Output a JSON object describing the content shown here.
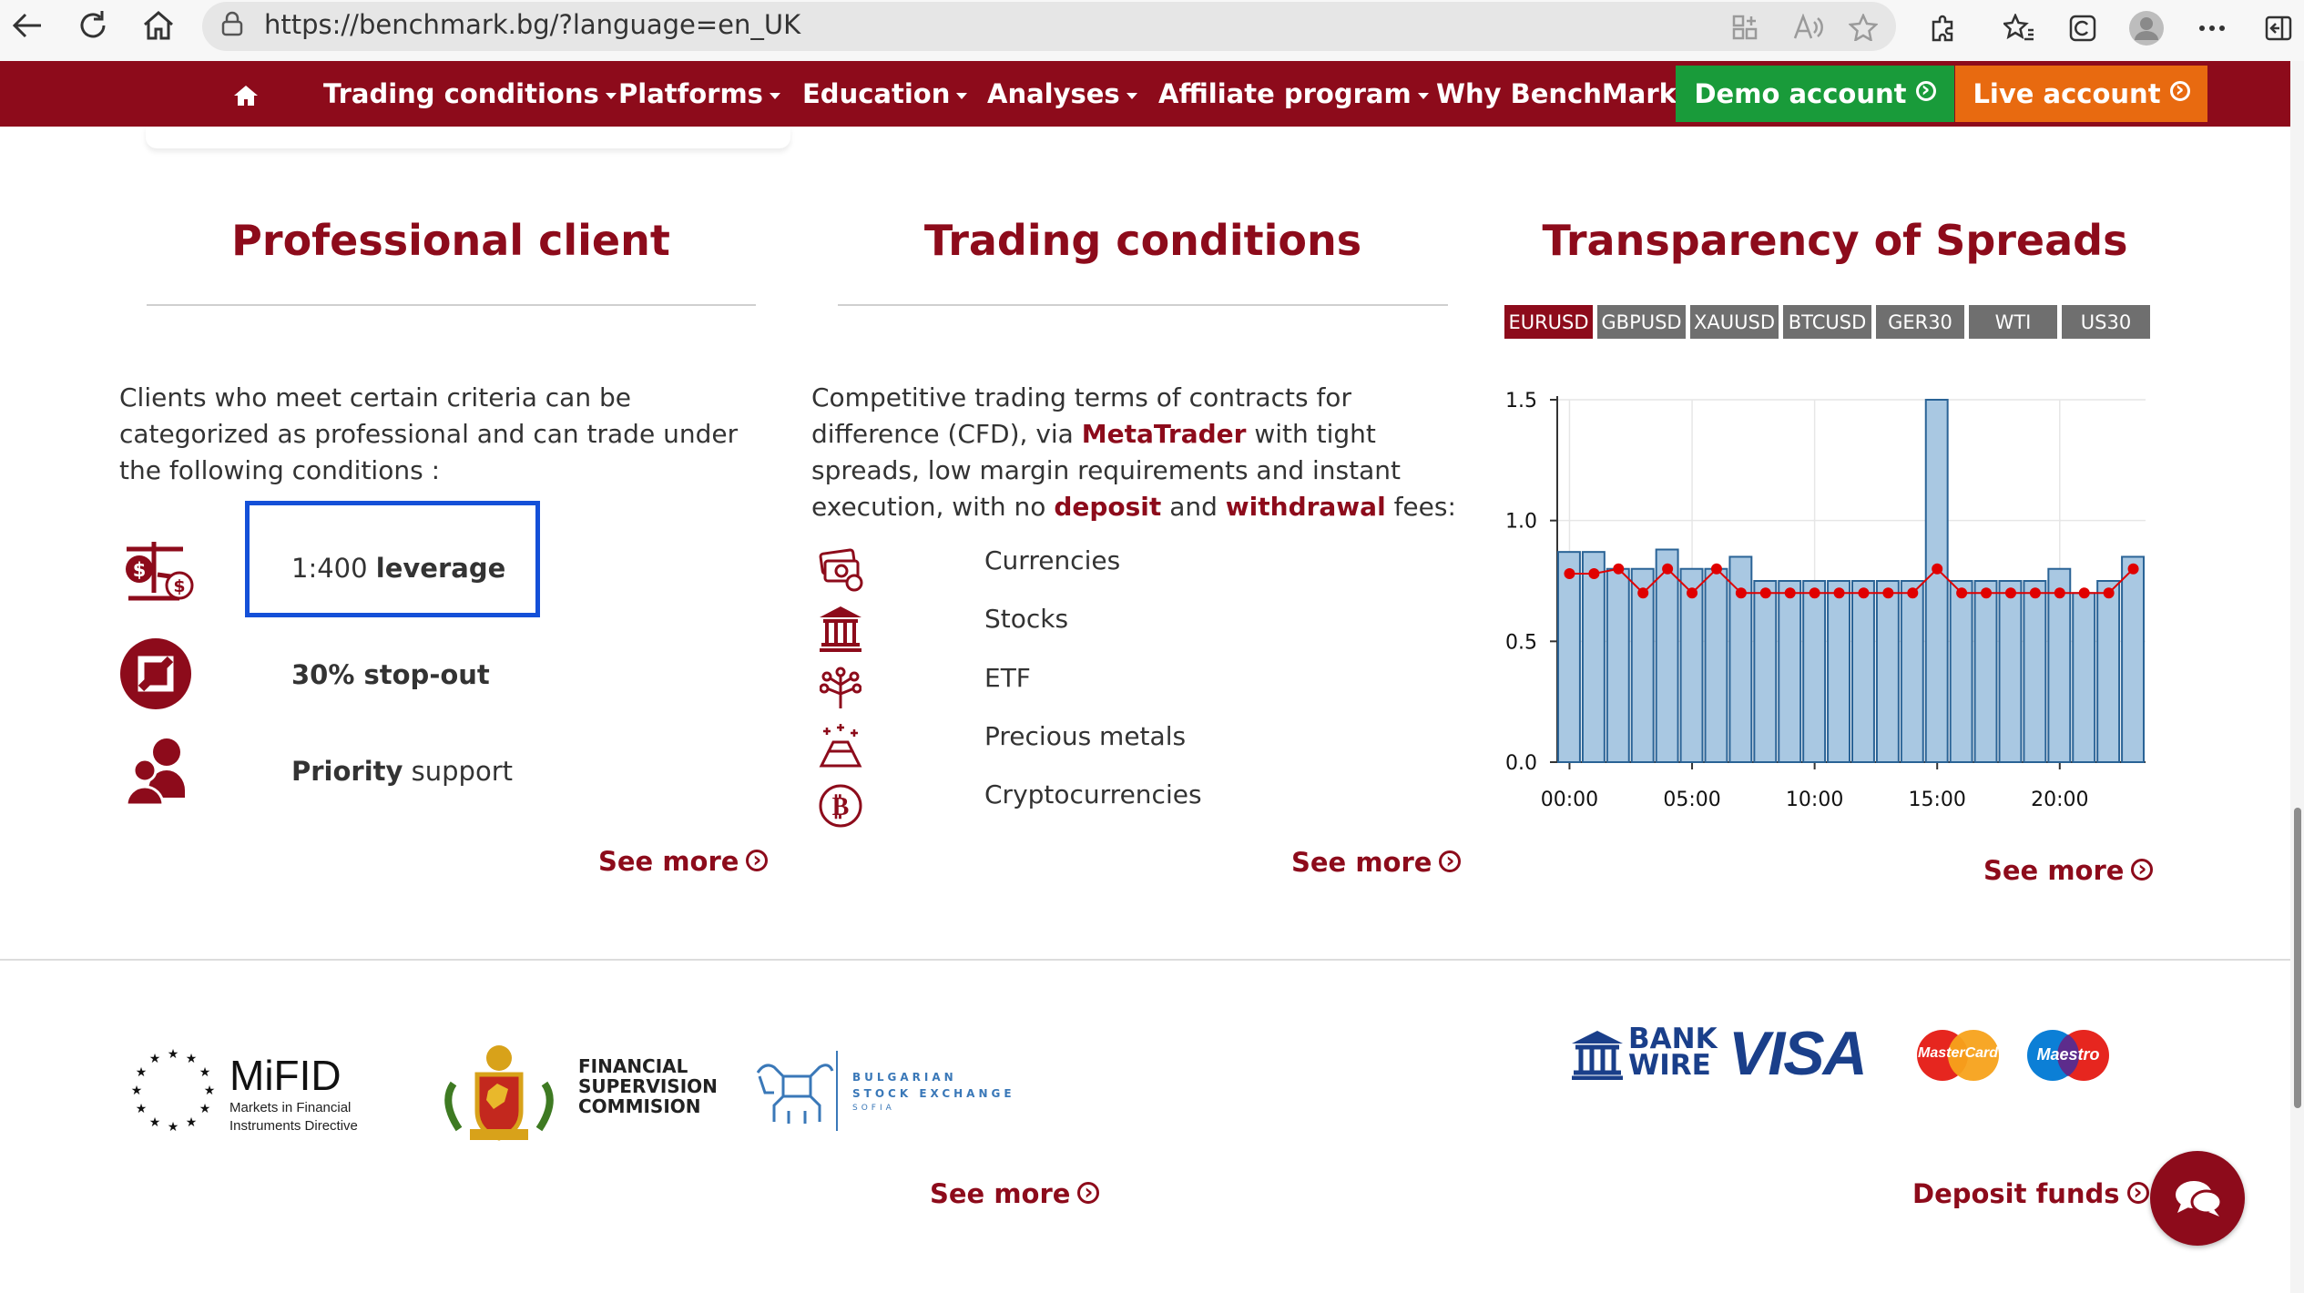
{
  "browser": {
    "url": "https://benchmark.bg/?language=en_UK"
  },
  "nav": {
    "items": [
      {
        "label": "Trading conditions"
      },
      {
        "label": "Platforms"
      },
      {
        "label": "Education"
      },
      {
        "label": "Analyses"
      },
      {
        "label": "Affiliate program"
      },
      {
        "label": "Why BenchMark"
      }
    ],
    "demo_label": "Demo account",
    "live_label": "Live account",
    "brand_color": "#8d0b1b",
    "demo_color": "#199b3a",
    "live_color": "#e86a10"
  },
  "professional": {
    "title": "Professional client",
    "intro": "Clients who meet certain criteria can be categorized as professional and can trade under the following conditions :",
    "features": [
      {
        "icon": "scales-icon",
        "pre": "1:400 ",
        "bold": "leverage",
        "post": ""
      },
      {
        "icon": "stop-out-icon",
        "pre": "",
        "bold": "30% stop-out",
        "post": ""
      },
      {
        "icon": "people-icon",
        "pre": "",
        "bold": "Priority",
        "post": " support"
      }
    ],
    "see_more": "See more"
  },
  "trading": {
    "title": "Trading conditions",
    "intro_1": "Competitive trading terms of contracts for difference (CFD), via ",
    "intro_link_1": "MetaTrader",
    "intro_2": " with tight spreads, low margin requirements and instant execution, with no ",
    "intro_link_2": "deposit",
    "intro_3": " and ",
    "intro_link_3": "withdrawal",
    "intro_4": " fees:",
    "instruments": [
      {
        "icon": "currencies-icon",
        "label": "Currencies"
      },
      {
        "icon": "bank-icon",
        "label": "Stocks"
      },
      {
        "icon": "etf-icon",
        "label": "ETF"
      },
      {
        "icon": "gold-icon",
        "label": "Precious metals"
      },
      {
        "icon": "bitcoin-icon",
        "label": "Cryptocurrencies"
      }
    ],
    "see_more": "See more"
  },
  "spreads": {
    "title": "Transparency of Spreads",
    "tabs": [
      "EURUSD",
      "GBPUSD",
      "XAUUSD",
      "BTCUSD",
      "GER30",
      "WTI",
      "US30"
    ],
    "active_tab": "EURUSD",
    "see_more": "See more"
  },
  "chart_data": {
    "type": "bar",
    "title": "",
    "xlabel": "",
    "ylabel": "",
    "x_ticks": [
      "00:00",
      "05:00",
      "10:00",
      "15:00",
      "20:00"
    ],
    "y_ticks": [
      "0.0",
      "0.5",
      "1.0",
      "1.5"
    ],
    "ylim": [
      0,
      1.5
    ],
    "categories": [
      "00:00",
      "01:00",
      "02:00",
      "03:00",
      "04:00",
      "05:00",
      "06:00",
      "07:00",
      "08:00",
      "09:00",
      "10:00",
      "11:00",
      "12:00",
      "13:00",
      "14:00",
      "15:00",
      "16:00",
      "17:00",
      "18:00",
      "19:00",
      "20:00",
      "21:00",
      "22:00",
      "23:00"
    ],
    "series": [
      {
        "values": [
          0.87,
          0.87,
          0.8,
          0.8,
          0.88,
          0.8,
          0.8,
          0.85,
          0.75,
          0.75,
          0.75,
          0.75,
          0.75,
          0.75,
          0.75,
          1.5,
          0.75,
          0.75,
          0.75,
          0.75,
          0.8,
          0.7,
          0.75,
          0.85
        ],
        "color": "#a9c8e2"
      },
      {
        "values": [
          0.78,
          0.78,
          0.8,
          0.7,
          0.8,
          0.7,
          0.8,
          0.7,
          0.7,
          0.7,
          0.7,
          0.7,
          0.7,
          0.7,
          0.7,
          0.8,
          0.7,
          0.7,
          0.7,
          0.7,
          0.7,
          0.7,
          0.7,
          0.8
        ],
        "color": "#e00000"
      }
    ],
    "grid": true
  },
  "footer": {
    "regulators": [
      {
        "name": "mifid-logo",
        "line1": "MiFID",
        "line2": "Markets in Financial",
        "line3": "Instruments Directive"
      },
      {
        "name": "fsc-logo",
        "line1": "FINANCIAL",
        "line2": "SUPERVISION",
        "line3": "COMMISION"
      },
      {
        "name": "bse-logo",
        "line1": "BULGARIAN",
        "line2": "STOCK EXCHANGE",
        "line3": "SOFIA"
      }
    ],
    "see_more": "See more",
    "payments": {
      "bank_line1": "BANK",
      "bank_line2": "WIRE",
      "visa": "VISA",
      "mastercard": "MasterCard",
      "maestro": "Maestro"
    },
    "deposit_label": "Deposit funds"
  }
}
